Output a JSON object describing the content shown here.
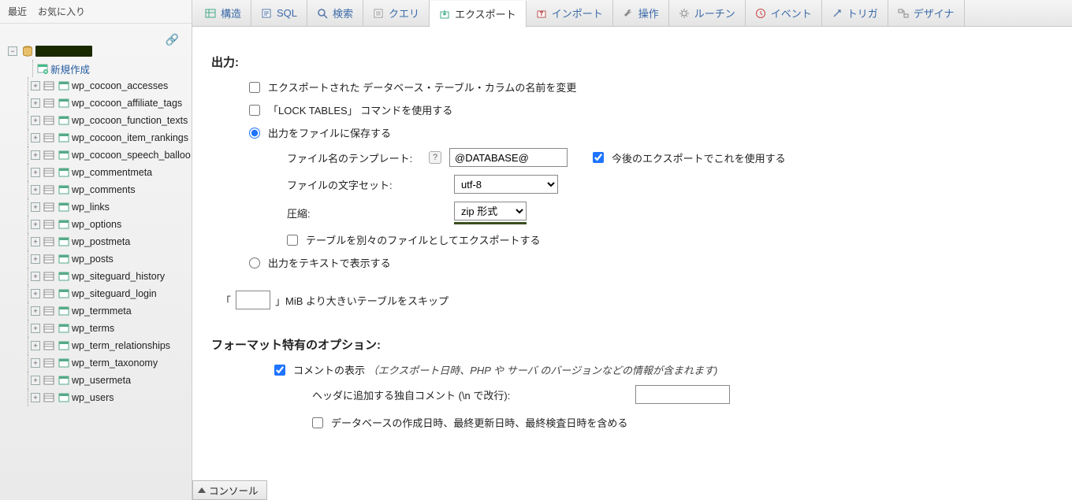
{
  "sidebar": {
    "tabs": {
      "recent": "最近",
      "favorites": "お気に入り"
    },
    "new_label": "新規作成",
    "tables": [
      "wp_cocoon_accesses",
      "wp_cocoon_affiliate_tags",
      "wp_cocoon_function_texts",
      "wp_cocoon_item_rankings",
      "wp_cocoon_speech_balloo",
      "wp_commentmeta",
      "wp_comments",
      "wp_links",
      "wp_options",
      "wp_postmeta",
      "wp_posts",
      "wp_siteguard_history",
      "wp_siteguard_login",
      "wp_termmeta",
      "wp_terms",
      "wp_term_relationships",
      "wp_term_taxonomy",
      "wp_usermeta",
      "wp_users"
    ]
  },
  "tabs": {
    "structure": "構造",
    "sql": "SQL",
    "search": "検索",
    "query": "クエリ",
    "export": "エクスポート",
    "import": "インポート",
    "operations": "操作",
    "routines": "ルーチン",
    "events": "イベント",
    "triggers": "トリガ",
    "designer": "デザイナ"
  },
  "export": {
    "output_heading": "出力:",
    "rename_label": "エクスポートされた データベース・テーブル・カラムの名前を変更",
    "lock_tables_label": "「LOCK TABLES」 コマンドを使用する",
    "save_as_file_label": "出力をファイルに保存する",
    "filename_template_label": "ファイル名のテンプレート:",
    "filename_template_value": "@DATABASE@",
    "remember_template_label": "今後のエクスポートでこれを使用する",
    "charset_label": "ファイルの文字セット:",
    "charset_value": "utf-8",
    "compression_label": "圧縮:",
    "compression_value": "zip 形式",
    "separate_files_label": "テーブルを別々のファイルとしてエクスポートする",
    "view_as_text_label": "出力をテキストで表示する",
    "skip_prefix": "「",
    "skip_value": "",
    "skip_suffix": "」MiB より大きいテーブルをスキップ",
    "format_heading": "フォーマット特有のオプション:",
    "comments_label": "コメントの表示",
    "comments_note": "（エクスポート日時、PHP や サーバ のバージョンなどの情報が含まれます)",
    "header_comment_label": "ヘッダに追加する独自コメント (\\n で改行):",
    "header_comment_value": "",
    "include_dates_label": "データベースの作成日時、最終更新日時、最終検査日時を含める"
  },
  "console_label": "コンソール"
}
